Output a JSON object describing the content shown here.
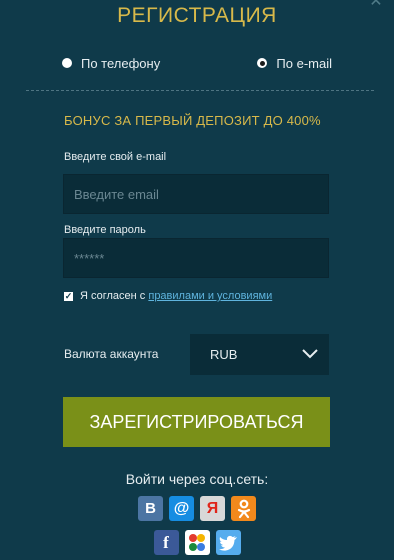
{
  "header": {
    "title": "РЕГИСТРАЦИЯ",
    "close_glyph": "✕"
  },
  "method": {
    "phone_label": "По телефону",
    "email_label": "По e-mail",
    "selected": "email"
  },
  "bonus": "БОНУС ЗА ПЕРВЫЙ ДЕПОЗИТ ДО 400%",
  "email_field": {
    "label": "Введите свой e-mail",
    "placeholder": "Введите email",
    "value": ""
  },
  "password_field": {
    "label": "Введите пароль",
    "placeholder": "******",
    "value": ""
  },
  "agreement": {
    "checked": true,
    "text": "Я согласен с",
    "link": "правилами и условиями"
  },
  "currency": {
    "label": "Валюта аккаунта",
    "value": "RUB"
  },
  "register_button": "ЗАРЕГИСТРИРОВАТЬСЯ",
  "social": {
    "label": "Войти через соц.сеть:",
    "networks_row1": [
      {
        "name": "vk",
        "glyph": "В",
        "icon": "vk-icon",
        "color": "#4c75a3"
      },
      {
        "name": "mail",
        "glyph": "@",
        "icon": "mailru-icon",
        "color": "#168de2"
      },
      {
        "name": "yandex",
        "glyph": "Я",
        "icon": "yandex-icon",
        "color": "#d8d8d8"
      },
      {
        "name": "ok",
        "glyph": "",
        "icon": "odnoklassniki-icon",
        "color": "#f2891c"
      }
    ],
    "networks_row2": [
      {
        "name": "facebook",
        "glyph": "f",
        "icon": "facebook-icon",
        "color": "#3b5998"
      },
      {
        "name": "google",
        "glyph": "",
        "icon": "google-icon",
        "color": "#ffffff"
      },
      {
        "name": "twitter",
        "glyph": "",
        "icon": "twitter-icon",
        "color": "#55acee"
      }
    ]
  },
  "colors": {
    "background": "#0f3a4a",
    "accent_gold": "#d8b94a",
    "button_green": "#7a9018",
    "link_blue": "#5fb4de"
  }
}
